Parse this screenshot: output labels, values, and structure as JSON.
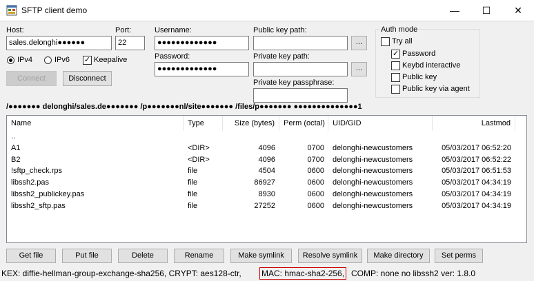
{
  "window": {
    "title": "SFTP client demo"
  },
  "connection": {
    "host_label": "Host:",
    "host_value": "sales.delonghi●●●●●●",
    "port_label": "Port:",
    "port_value": "22",
    "ipv4_label": "IPv4",
    "ipv6_label": "IPv6",
    "keepalive_label": "Keepalive",
    "connect_label": "Connect",
    "disconnect_label": "Disconnect"
  },
  "credentials": {
    "username_label": "Username:",
    "username_value": "●●●●●●●●●●●●●",
    "password_label": "Password:",
    "password_value": "●●●●●●●●●●●●●"
  },
  "keys": {
    "public_label": "Public key path:",
    "private_label": "Private key path:",
    "passphrase_label": "Private key passphrase:",
    "browse_label": "..."
  },
  "auth": {
    "title": "Auth mode",
    "options": [
      {
        "label": "Try all",
        "checked": false
      },
      {
        "label": "Password",
        "checked": true
      },
      {
        "label": "Keybd interactive",
        "checked": false
      },
      {
        "label": "Public key",
        "checked": false
      },
      {
        "label": "Public key via agent",
        "checked": false
      }
    ]
  },
  "path": "/●●●●●●● delonghi/sales.de●●●●●●● /p●●●●●●●nl/site●●●●●●● /files/p●●●●●●● ●●●●●●●●●●●●●●1",
  "table": {
    "headers": [
      "Name",
      "Type",
      "Size (bytes)",
      "Perm (octal)",
      "UID/GID",
      "Lastmod"
    ],
    "rows": [
      [
        "..",
        "",
        "",
        "",
        "",
        ""
      ],
      [
        "A1",
        "<DIR>",
        "4096",
        "0700",
        "delonghi-newcustomers",
        "05/03/2017 06:52:20"
      ],
      [
        "B2",
        "<DIR>",
        "4096",
        "0700",
        "delonghi-newcustomers",
        "05/03/2017 06:52:22"
      ],
      [
        "!sftp_check.rps",
        "file",
        "4504",
        "0600",
        "delonghi-newcustomers",
        "05/03/2017 06:51:53"
      ],
      [
        "libssh2.pas",
        "file",
        "86927",
        "0600",
        "delonghi-newcustomers",
        "05/03/2017 04:34:19"
      ],
      [
        "libssh2_publickey.pas",
        "file",
        "8930",
        "0600",
        "delonghi-newcustomers",
        "05/03/2017 04:34:19"
      ],
      [
        "libssh2_sftp.pas",
        "file",
        "27252",
        "0600",
        "delonghi-newcustomers",
        "05/03/2017 04:34:19"
      ]
    ]
  },
  "actions": [
    "Get file",
    "Put file",
    "Delete",
    "Rename",
    "Make symlink",
    "Resolve symlink",
    "Make directory",
    "Set perms"
  ],
  "status": {
    "part1": "KEX: diffie-hellman-group-exchange-sha256, CRYPT: aes128-ctr,",
    "mac": "MAC: hmac-sha2-256,",
    "part2": "COMP: none no libssh2 ver: 1.8.0"
  },
  "colors": {
    "focus_border": "#0078d7",
    "highlight": "#cc0000"
  }
}
